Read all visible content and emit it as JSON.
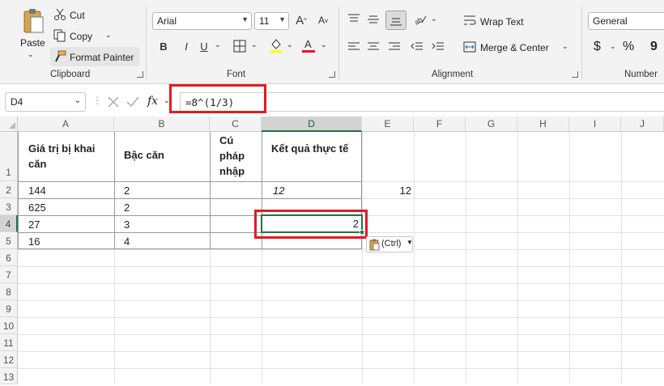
{
  "ribbon": {
    "clipboard": {
      "paste": "Paste",
      "cut": "Cut",
      "copy": "Copy",
      "format_painter": "Format Painter",
      "label": "Clipboard"
    },
    "font": {
      "name": "Arial",
      "size": "11",
      "bold": "B",
      "italic": "I",
      "underline": "U",
      "label": "Font",
      "fill_color": "#ffff00",
      "font_color": "#e21b22"
    },
    "alignment": {
      "wrap_text": "Wrap Text",
      "merge_center": "Merge & Center",
      "label": "Alignment"
    },
    "number": {
      "format": "General",
      "currency": "$",
      "percent": "%",
      "comma": "9",
      "label": "Number"
    }
  },
  "formula_bar": {
    "name_box": "D4",
    "fx": "fx",
    "formula": "=8^(1/3)"
  },
  "columns": [
    "A",
    "B",
    "C",
    "D",
    "E",
    "F",
    "G",
    "H",
    "I",
    "J"
  ],
  "rows": [
    "1",
    "2",
    "3",
    "4",
    "5",
    "6",
    "7",
    "8",
    "9",
    "10",
    "11",
    "12",
    "13"
  ],
  "cells": {
    "A1": "Giá trị bị khai căn",
    "B1": "Bậc căn",
    "C1": "Cú pháp nhập",
    "D1": "Kết quả thực tế",
    "A2": "144",
    "B2": "2",
    "D2": "12",
    "E2": "12",
    "A3": "625",
    "B3": "2",
    "A4": "27",
    "B4": "3",
    "D4": "2",
    "A5": "16",
    "B5": "4"
  },
  "paste_options": "(Ctrl)",
  "colors": {
    "highlight": "#e21b22",
    "selection": "#217346"
  }
}
